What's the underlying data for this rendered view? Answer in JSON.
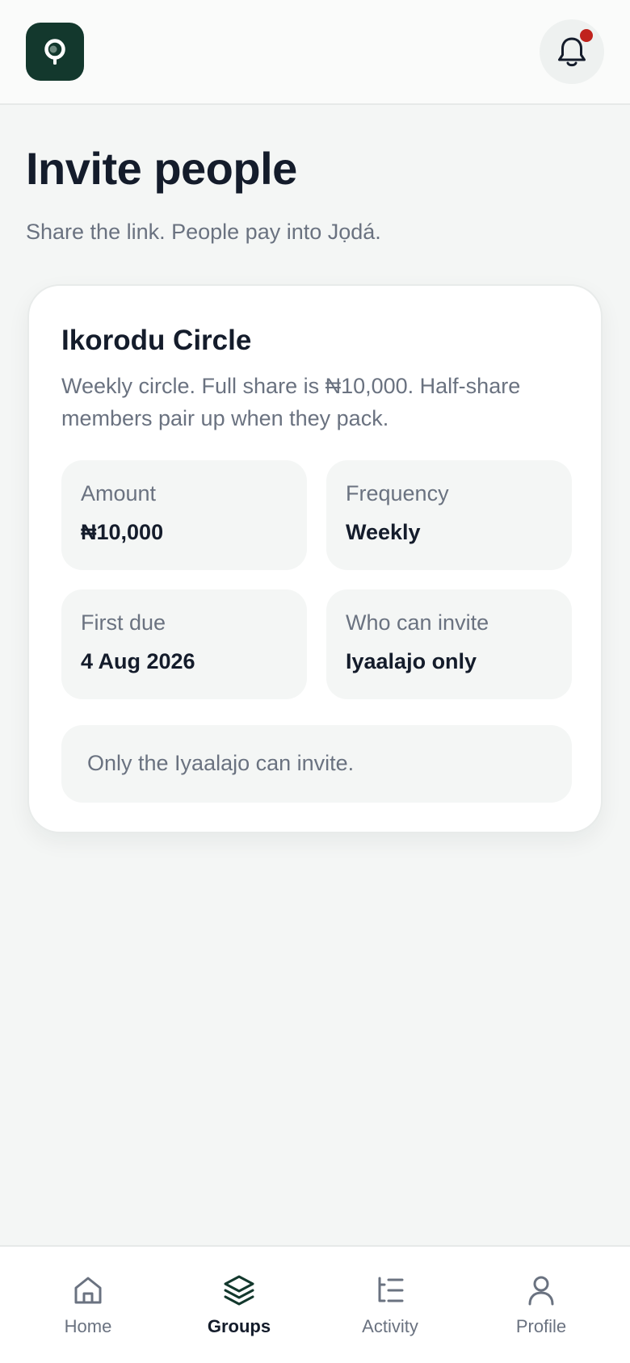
{
  "header": {
    "logo_icon": "app-logo-icon",
    "bell_icon": "bell-icon",
    "has_notification": true,
    "notification_dot_color": "#c0231d"
  },
  "page": {
    "title": "Invite people",
    "subtitle": "Share the link. People pay into Jọdá."
  },
  "group": {
    "name": "Ikorodu Circle",
    "description": "Weekly circle. Full share is ₦10,000. Half-share members pair up when they pack.",
    "details": [
      {
        "label": "Amount",
        "value": "₦10,000"
      },
      {
        "label": "Frequency",
        "value": "Weekly"
      },
      {
        "label": "First due",
        "value": "4 Aug 2026"
      },
      {
        "label": "Who can invite",
        "value": "Iyaalajo only"
      }
    ],
    "invite_note": "Only the Iyaalajo can invite."
  },
  "nav": {
    "active": "Groups",
    "items": [
      {
        "label": "Home",
        "icon": "home-icon"
      },
      {
        "label": "Groups",
        "icon": "layers-icon"
      },
      {
        "label": "Activity",
        "icon": "activity-list-icon"
      },
      {
        "label": "Profile",
        "icon": "user-icon"
      }
    ]
  },
  "colors": {
    "brand": "#13382d",
    "background": "#f4f6f5",
    "text_primary": "#141c2b",
    "text_secondary": "#6a7280"
  }
}
